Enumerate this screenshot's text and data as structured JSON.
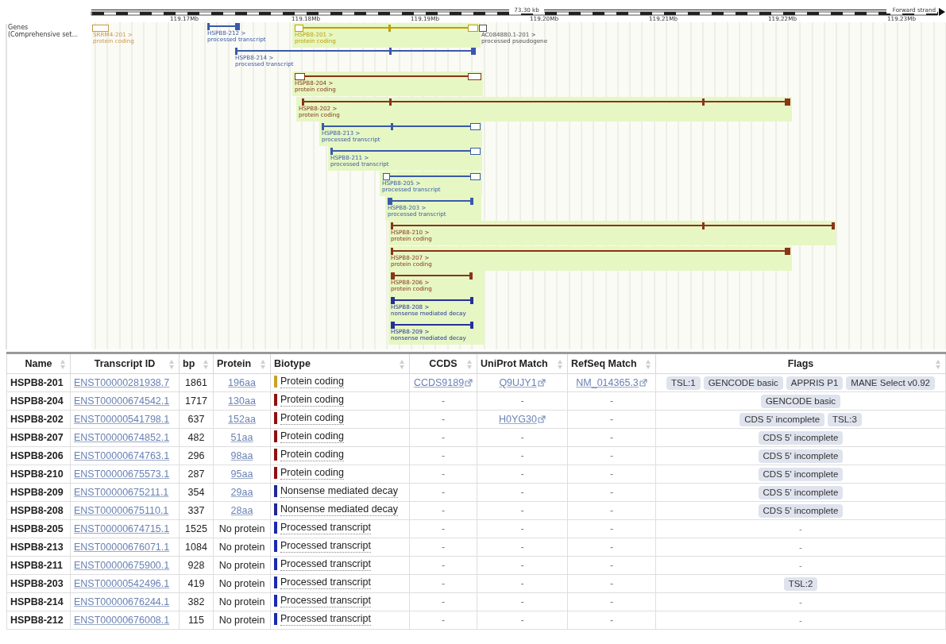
{
  "ruler": {
    "span": "73.30 kb",
    "strand": "Forward strand",
    "ticks": [
      "119.17Mb",
      "119.18Mb",
      "119.19Mb",
      "119.20Mb",
      "119.21Mb",
      "119.22Mb",
      "119.23Mb"
    ]
  },
  "track": {
    "label": "Genes",
    "sublabel": "(Comprehensive set..."
  },
  "transcripts": [
    {
      "name": "SRRM4-201 >",
      "biotype": "protein coding",
      "color": "#c8984a",
      "highlighted": false
    },
    {
      "name": "HSPB8-212 >",
      "biotype": "processed transcript",
      "color": "#3a5aa8",
      "highlighted": false
    },
    {
      "name": "HSPB8-201 >",
      "biotype": "protein coding",
      "color": "#bfa000",
      "highlighted": true
    },
    {
      "name": "AC084880.1-201 >",
      "biotype": "processed pseudogene",
      "color": "#505050",
      "highlighted": false
    },
    {
      "name": "HSPB8-214 >",
      "biotype": "processed transcript",
      "color": "#3a5aa8",
      "highlighted": false
    },
    {
      "name": "HSPB8-204 >",
      "biotype": "protein coding",
      "color": "#8a3418",
      "highlighted": true
    },
    {
      "name": "HSPB8-202 >",
      "biotype": "protein coding",
      "color": "#8a3418",
      "highlighted": true
    },
    {
      "name": "HSPB8-213 >",
      "biotype": "processed transcript",
      "color": "#3a5aa8",
      "highlighted": true
    },
    {
      "name": "HSPB8-211 >",
      "biotype": "processed transcript",
      "color": "#3a5aa8",
      "highlighted": true
    },
    {
      "name": "HSPB8-205 >",
      "biotype": "processed transcript",
      "color": "#3a5aa8",
      "highlighted": true
    },
    {
      "name": "HSPB8-203 >",
      "biotype": "processed transcript",
      "color": "#3a5aa8",
      "highlighted": true
    },
    {
      "name": "HSPB8-210 >",
      "biotype": "protein coding",
      "color": "#8a3418",
      "highlighted": true
    },
    {
      "name": "HSPB8-207 >",
      "biotype": "protein coding",
      "color": "#8a3418",
      "highlighted": true
    },
    {
      "name": "HSPB8-206 >",
      "biotype": "protein coding",
      "color": "#8a3418",
      "highlighted": true
    },
    {
      "name": "HSPB8-208 >",
      "biotype": "nonsense mediated decay",
      "color": "#24309a",
      "highlighted": true
    },
    {
      "name": "HSPB8-209 >",
      "biotype": "nonsense mediated decay",
      "color": "#24309a",
      "highlighted": true
    }
  ],
  "table": {
    "columns": [
      "Name",
      "Transcript ID",
      "bp",
      "Protein",
      "Biotype",
      "CCDS",
      "UniProt Match",
      "RefSeq Match",
      "Flags"
    ],
    "rows": [
      {
        "name": "HSPB8-201",
        "transcript_id": "ENST00000281938.7",
        "bp": "1861",
        "protein": {
          "text": "196aa",
          "link": true
        },
        "biotype": "Protein coding",
        "color": "#c9a227",
        "ccds": {
          "text": "CCDS9189",
          "link": true
        },
        "uniprot": {
          "text": "Q9UJY1",
          "link": true
        },
        "refseq": {
          "text": "NM_014365.3",
          "link": true
        },
        "flags": [
          "TSL:1",
          "GENCODE basic",
          "APPRIS P1",
          "MANE Select v0.92"
        ]
      },
      {
        "name": "HSPB8-204",
        "transcript_id": "ENST00000674542.1",
        "bp": "1717",
        "protein": {
          "text": "130aa",
          "link": true
        },
        "biotype": "Protein coding",
        "color": "#8e1010",
        "ccds": {
          "text": "-",
          "link": false
        },
        "uniprot": {
          "text": "-",
          "link": false
        },
        "refseq": {
          "text": "-",
          "link": false
        },
        "flags": [
          "GENCODE basic"
        ]
      },
      {
        "name": "HSPB8-202",
        "transcript_id": "ENST00000541798.1",
        "bp": "637",
        "protein": {
          "text": "152aa",
          "link": true
        },
        "biotype": "Protein coding",
        "color": "#8e1010",
        "ccds": {
          "text": "-",
          "link": false
        },
        "uniprot": {
          "text": "H0YG30",
          "link": true
        },
        "refseq": {
          "text": "-",
          "link": false
        },
        "flags": [
          "CDS 5' incomplete",
          "TSL:3"
        ]
      },
      {
        "name": "HSPB8-207",
        "transcript_id": "ENST00000674852.1",
        "bp": "482",
        "protein": {
          "text": "51aa",
          "link": true
        },
        "biotype": "Protein coding",
        "color": "#8e1010",
        "ccds": {
          "text": "-",
          "link": false
        },
        "uniprot": {
          "text": "-",
          "link": false
        },
        "refseq": {
          "text": "-",
          "link": false
        },
        "flags": [
          "CDS 5' incomplete"
        ]
      },
      {
        "name": "HSPB8-206",
        "transcript_id": "ENST00000674763.1",
        "bp": "296",
        "protein": {
          "text": "98aa",
          "link": true
        },
        "biotype": "Protein coding",
        "color": "#8e1010",
        "ccds": {
          "text": "-",
          "link": false
        },
        "uniprot": {
          "text": "-",
          "link": false
        },
        "refseq": {
          "text": "-",
          "link": false
        },
        "flags": [
          "CDS 5' incomplete"
        ]
      },
      {
        "name": "HSPB8-210",
        "transcript_id": "ENST00000675573.1",
        "bp": "287",
        "protein": {
          "text": "95aa",
          "link": true
        },
        "biotype": "Protein coding",
        "color": "#8e1010",
        "ccds": {
          "text": "-",
          "link": false
        },
        "uniprot": {
          "text": "-",
          "link": false
        },
        "refseq": {
          "text": "-",
          "link": false
        },
        "flags": [
          "CDS 5' incomplete"
        ]
      },
      {
        "name": "HSPB8-209",
        "transcript_id": "ENST00000675211.1",
        "bp": "354",
        "protein": {
          "text": "29aa",
          "link": true
        },
        "biotype": "Nonsense mediated decay",
        "color": "#1e2896",
        "ccds": {
          "text": "-",
          "link": false
        },
        "uniprot": {
          "text": "-",
          "link": false
        },
        "refseq": {
          "text": "-",
          "link": false
        },
        "flags": [
          "CDS 5' incomplete"
        ]
      },
      {
        "name": "HSPB8-208",
        "transcript_id": "ENST00000675110.1",
        "bp": "337",
        "protein": {
          "text": "28aa",
          "link": true
        },
        "biotype": "Nonsense mediated decay",
        "color": "#1e2896",
        "ccds": {
          "text": "-",
          "link": false
        },
        "uniprot": {
          "text": "-",
          "link": false
        },
        "refseq": {
          "text": "-",
          "link": false
        },
        "flags": [
          "CDS 5' incomplete"
        ]
      },
      {
        "name": "HSPB8-205",
        "transcript_id": "ENST00000674715.1",
        "bp": "1525",
        "protein": {
          "text": "No protein",
          "link": false
        },
        "biotype": "Processed transcript",
        "color": "#1a2ab0",
        "ccds": {
          "text": "-",
          "link": false
        },
        "uniprot": {
          "text": "-",
          "link": false
        },
        "refseq": {
          "text": "-",
          "link": false
        },
        "flags": [
          "-"
        ]
      },
      {
        "name": "HSPB8-213",
        "transcript_id": "ENST00000676071.1",
        "bp": "1084",
        "protein": {
          "text": "No protein",
          "link": false
        },
        "biotype": "Processed transcript",
        "color": "#1a2ab0",
        "ccds": {
          "text": "-",
          "link": false
        },
        "uniprot": {
          "text": "-",
          "link": false
        },
        "refseq": {
          "text": "-",
          "link": false
        },
        "flags": [
          "-"
        ]
      },
      {
        "name": "HSPB8-211",
        "transcript_id": "ENST00000675900.1",
        "bp": "928",
        "protein": {
          "text": "No protein",
          "link": false
        },
        "biotype": "Processed transcript",
        "color": "#1a2ab0",
        "ccds": {
          "text": "-",
          "link": false
        },
        "uniprot": {
          "text": "-",
          "link": false
        },
        "refseq": {
          "text": "-",
          "link": false
        },
        "flags": [
          "-"
        ]
      },
      {
        "name": "HSPB8-203",
        "transcript_id": "ENST00000542496.1",
        "bp": "419",
        "protein": {
          "text": "No protein",
          "link": false
        },
        "biotype": "Processed transcript",
        "color": "#1a2ab0",
        "ccds": {
          "text": "-",
          "link": false
        },
        "uniprot": {
          "text": "-",
          "link": false
        },
        "refseq": {
          "text": "-",
          "link": false
        },
        "flags": [
          "TSL:2"
        ]
      },
      {
        "name": "HSPB8-214",
        "transcript_id": "ENST00000676244.1",
        "bp": "382",
        "protein": {
          "text": "No protein",
          "link": false
        },
        "biotype": "Processed transcript",
        "color": "#1a2ab0",
        "ccds": {
          "text": "-",
          "link": false
        },
        "uniprot": {
          "text": "-",
          "link": false
        },
        "refseq": {
          "text": "-",
          "link": false
        },
        "flags": [
          "-"
        ]
      },
      {
        "name": "HSPB8-212",
        "transcript_id": "ENST00000676008.1",
        "bp": "115",
        "protein": {
          "text": "No protein",
          "link": false
        },
        "biotype": "Processed transcript",
        "color": "#1a2ab0",
        "ccds": {
          "text": "-",
          "link": false
        },
        "uniprot": {
          "text": "-",
          "link": false
        },
        "refseq": {
          "text": "-",
          "link": false
        },
        "flags": [
          "-"
        ]
      }
    ]
  }
}
